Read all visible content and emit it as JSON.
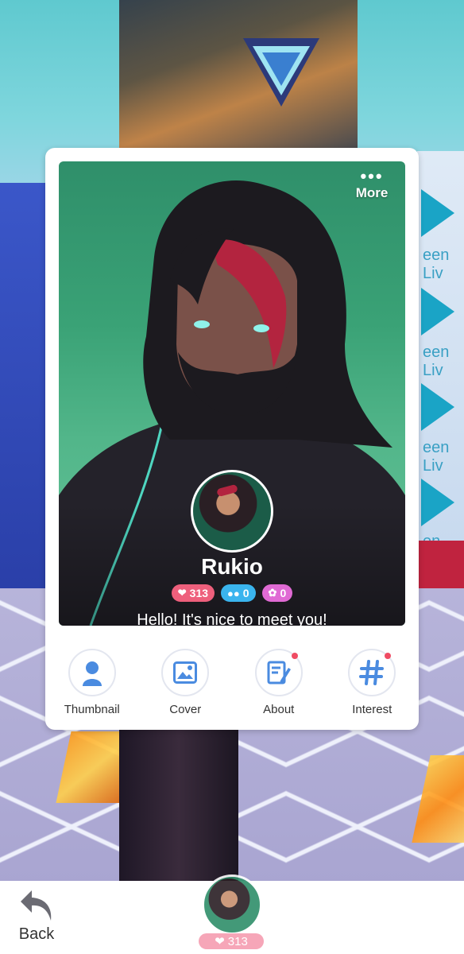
{
  "profile": {
    "menu_dots": "•••",
    "more_label": "More",
    "name": "Rukio",
    "greeting": "Hello! It's nice to meet you!",
    "stats": {
      "likes": "313",
      "friends": "0",
      "gifts": "0"
    }
  },
  "actions": [
    {
      "label": "Thumbnail",
      "icon": "person-icon",
      "has_dot": false
    },
    {
      "label": "Cover",
      "icon": "image-icon",
      "has_dot": false
    },
    {
      "label": "About",
      "icon": "edit-note-icon",
      "has_dot": true
    },
    {
      "label": "Interest",
      "icon": "hashtag-icon",
      "has_dot": true
    }
  ],
  "bottom_bar": {
    "back_label": "Back",
    "likes_count": "313"
  },
  "background": {
    "screen_texts": [
      "een Liv",
      "een Liv",
      "een Liv",
      "en Live"
    ]
  },
  "colors": {
    "accent_blue": "#3a7fd0",
    "likes_pink": "#ee5f7c",
    "friends_blue": "#3ab4ee",
    "gifts_magenta": "#e06ad4",
    "notify_red": "#ef4b63",
    "portrait_green": "#3aa276"
  }
}
